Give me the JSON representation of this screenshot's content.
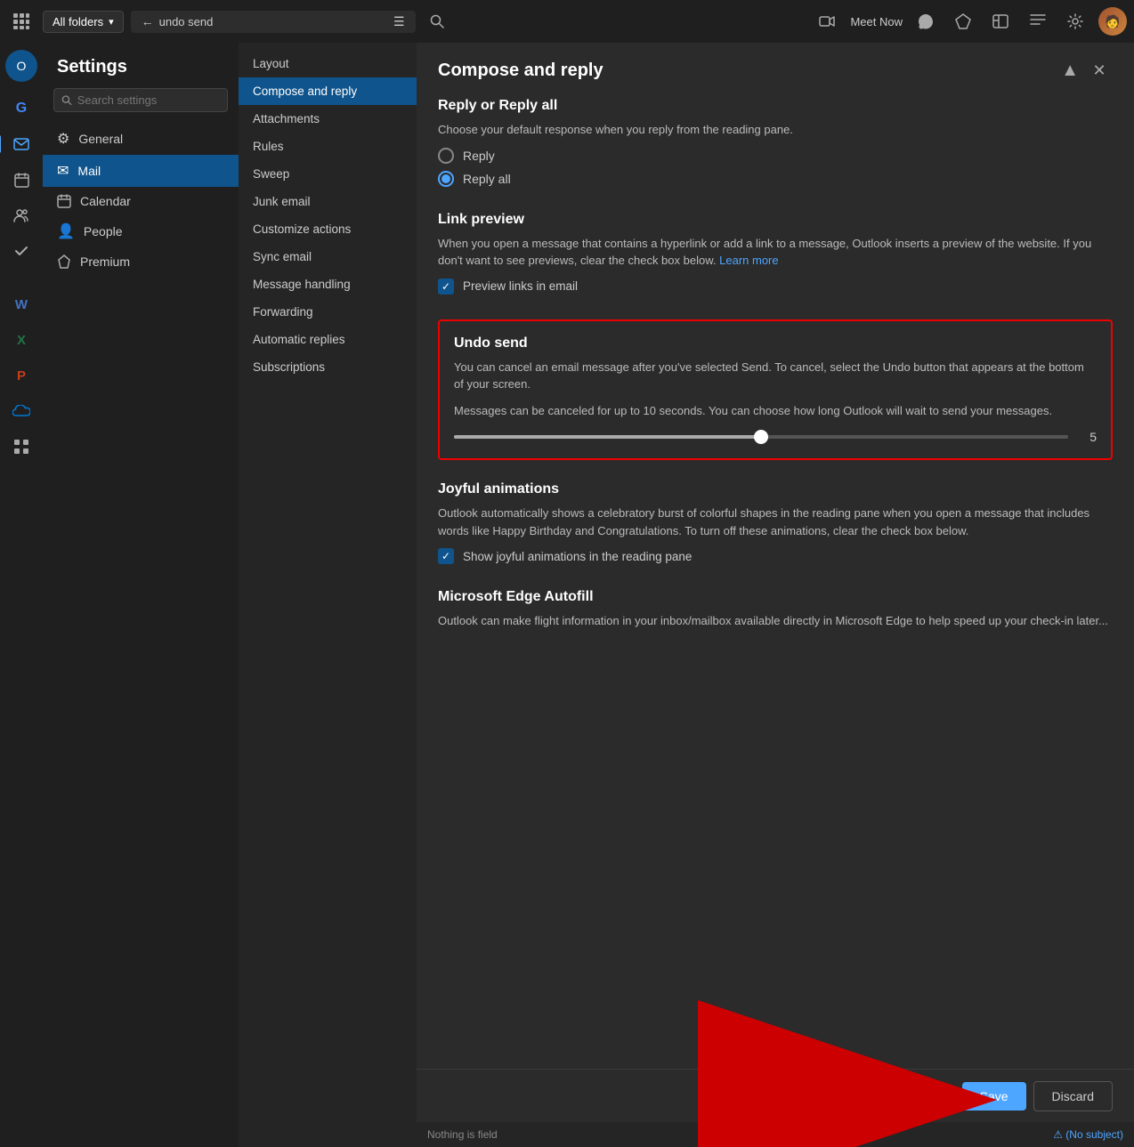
{
  "topbar": {
    "folder_label": "All folders",
    "undo_send_text": "undo send",
    "meet_now_label": "Meet Now",
    "search_tooltip": "Search"
  },
  "icon_sidebar": {
    "items": [
      {
        "id": "waffle",
        "icon": "⊞",
        "active": false
      },
      {
        "id": "outlook",
        "icon": "✉",
        "active": false
      },
      {
        "id": "google",
        "icon": "G",
        "active": false
      },
      {
        "id": "mail",
        "icon": "✉",
        "active": true
      },
      {
        "id": "calendar",
        "icon": "▦",
        "active": false
      },
      {
        "id": "people",
        "icon": "👥",
        "active": false
      },
      {
        "id": "tasks",
        "icon": "✔",
        "active": false
      },
      {
        "id": "word",
        "icon": "W",
        "active": false
      },
      {
        "id": "excel",
        "icon": "X",
        "active": false
      },
      {
        "id": "ppt",
        "icon": "P",
        "active": false
      },
      {
        "id": "onedrive",
        "icon": "☁",
        "active": false
      },
      {
        "id": "apps",
        "icon": "⊞",
        "active": false
      }
    ]
  },
  "settings_nav": {
    "title": "Settings",
    "search_placeholder": "Search settings",
    "items": [
      {
        "id": "general",
        "label": "General",
        "icon": "⚙",
        "active": false
      },
      {
        "id": "mail",
        "label": "Mail",
        "icon": "✉",
        "active": true
      },
      {
        "id": "calendar",
        "label": "Calendar",
        "icon": "▦",
        "active": false
      },
      {
        "id": "people",
        "label": "People",
        "icon": "👤",
        "active": false
      },
      {
        "id": "premium",
        "label": "Premium",
        "icon": "◈",
        "active": false
      }
    ]
  },
  "submenu": {
    "items": [
      {
        "id": "layout",
        "label": "Layout",
        "active": false
      },
      {
        "id": "compose-reply",
        "label": "Compose and reply",
        "active": true
      },
      {
        "id": "attachments",
        "label": "Attachments",
        "active": false
      },
      {
        "id": "rules",
        "label": "Rules",
        "active": false
      },
      {
        "id": "sweep",
        "label": "Sweep",
        "active": false
      },
      {
        "id": "junk-email",
        "label": "Junk email",
        "active": false
      },
      {
        "id": "customize-actions",
        "label": "Customize actions",
        "active": false
      },
      {
        "id": "sync-email",
        "label": "Sync email",
        "active": false
      },
      {
        "id": "message-handling",
        "label": "Message handling",
        "active": false
      },
      {
        "id": "forwarding",
        "label": "Forwarding",
        "active": false
      },
      {
        "id": "automatic-replies",
        "label": "Automatic replies",
        "active": false
      },
      {
        "id": "subscriptions",
        "label": "Subscriptions",
        "active": false
      }
    ]
  },
  "panel": {
    "title": "Compose and reply",
    "sections": {
      "reply_or_reply_all": {
        "title": "Reply or Reply all",
        "description": "Choose your default response when you reply from the reading pane.",
        "options": [
          {
            "id": "reply",
            "label": "Reply",
            "checked": false
          },
          {
            "id": "reply_all",
            "label": "Reply all",
            "checked": true
          }
        ]
      },
      "link_preview": {
        "title": "Link preview",
        "description": "When you open a message that contains a hyperlink or add a link to a message, Outlook inserts a preview of the website. If you don't want to see previews, clear the check box below.",
        "learn_more": "Learn more",
        "checkbox_label": "Preview links in email",
        "checked": true
      },
      "undo_send": {
        "title": "Undo send",
        "description1": "You can cancel an email message after you've selected Send. To cancel, select the Undo button that appears at the bottom of your screen.",
        "description2": "Messages can be canceled for up to 10 seconds. You can choose how long Outlook will wait to send your messages.",
        "slider_value": "5",
        "slider_percent": 50
      },
      "joyful_animations": {
        "title": "Joyful animations",
        "description": "Outlook automatically shows a celebratory burst of colorful shapes in the reading pane when you open a message that includes words like Happy Birthday and Congratulations. To turn off these animations, clear the check box below.",
        "checkbox_label": "Show joyful animations in the reading pane",
        "checked": true
      },
      "microsoft_edge_autofill": {
        "title": "Microsoft Edge Autofill",
        "description": "Outlook can make flight information in your inbox/mailbox available directly in Microsoft Edge to help speed up your check-in later..."
      }
    }
  },
  "bottom_bar": {
    "save_label": "Save",
    "discard_label": "Discard",
    "nothing_label": "Nothing is field"
  },
  "colors": {
    "accent": "#4da6ff",
    "highlight_border": "#e00000",
    "active_nav": "#0f548c"
  }
}
